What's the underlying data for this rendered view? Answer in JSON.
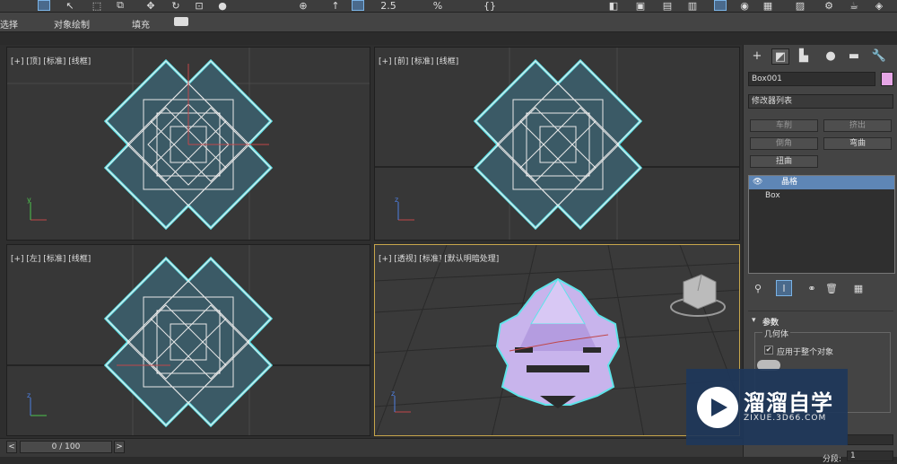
{
  "menubar": {
    "items": [
      "选择",
      "对象绘制",
      "填充"
    ]
  },
  "toolbar": {
    "snap_label": "2.5",
    "percent_label": "%"
  },
  "viewports": {
    "top": {
      "label": "[+] [顶] [标准] [线框]"
    },
    "front": {
      "label": "[+] [前] [标准] [线框]"
    },
    "left": {
      "label": "[+] [左] [标准] [线框]"
    },
    "perspective": {
      "label": "[+] [透视] [标准] [默认明暗处理]"
    }
  },
  "timebar": {
    "frame": "0 / 100",
    "prev": "<",
    "next": ">"
  },
  "command_panel": {
    "tabs": [
      "create-icon",
      "modify-icon",
      "hierarchy-icon",
      "motion-icon",
      "display-icon",
      "utilities-icon"
    ],
    "object_name": "Box001",
    "object_color": "#e6a6e6",
    "modifier_list": "修改器列表",
    "mod_buttons": [
      "车削",
      "挤出",
      "倒角",
      "弯曲",
      "扭曲"
    ],
    "stack": {
      "item1": "晶格",
      "item2": "Box"
    },
    "params_title": "参数",
    "geometry_title": "几何体",
    "apply_all_label": "应用于整个对象",
    "segments_label": "分段:",
    "segments_value": "1"
  },
  "watermark": {
    "title": "溜溜自学",
    "url": "ZIXUE.3D66.COM"
  }
}
